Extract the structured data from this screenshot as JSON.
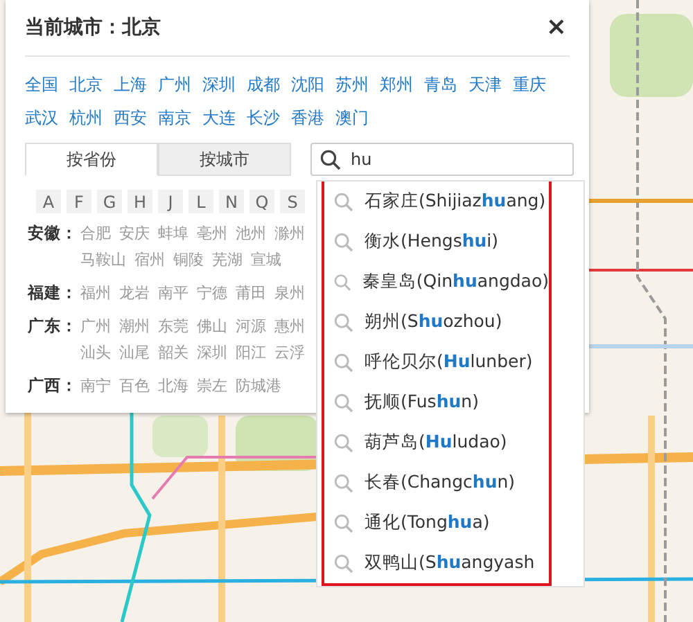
{
  "panel": {
    "title": "当前城市：北京",
    "close": "×",
    "hot_cities": [
      "全国",
      "北京",
      "上海",
      "广州",
      "深圳",
      "成都",
      "沈阳",
      "苏州",
      "郑州",
      "青岛",
      "天津",
      "重庆",
      "武汉",
      "杭州",
      "西安",
      "南京",
      "大连",
      "长沙",
      "香港",
      "澳门"
    ],
    "tabs": [
      {
        "label": "按省份",
        "selected": true
      },
      {
        "label": "按城市",
        "selected": false
      }
    ],
    "search": {
      "value": "hu"
    },
    "letters": [
      "A",
      "F",
      "G",
      "H",
      "J",
      "L",
      "N",
      "Q",
      "S"
    ],
    "provinces": [
      {
        "name": "安徽：",
        "cities": [
          "合肥",
          "安庆",
          "蚌埠",
          "亳州",
          "池州",
          "滁州",
          "马鞍山",
          "宿州",
          "铜陵",
          "芜湖",
          "宣城"
        ]
      },
      {
        "name": "福建：",
        "cities": [
          "福州",
          "龙岩",
          "南平",
          "宁德",
          "莆田",
          "泉州"
        ]
      },
      {
        "name": "广东：",
        "cities": [
          "广州",
          "潮州",
          "东莞",
          "佛山",
          "河源",
          "惠州",
          "汕头",
          "汕尾",
          "韶关",
          "深圳",
          "阳江",
          "云浮"
        ]
      },
      {
        "name": "广西：",
        "cities": [
          "南宁",
          "百色",
          "北海",
          "崇左",
          "防城港"
        ]
      }
    ]
  },
  "suggestions": [
    {
      "label": "石家庄(Shijiaz**hu**ang)"
    },
    {
      "label": "衡水(Hengs**hu**i)"
    },
    {
      "label": "秦皇岛(Qin**hu**angdao)"
    },
    {
      "label": "朔州(S**hu**ozhou)"
    },
    {
      "label": "呼伦贝尔(**Hu**lunber)"
    },
    {
      "label": "抚顺(Fus**hu**n)"
    },
    {
      "label": "葫芦岛(**Hu**ludao)"
    },
    {
      "label": "长春(Changc**hu**n)"
    },
    {
      "label": "通化(Tong**hu**a)"
    },
    {
      "label": "双鸭山(S**hu**angyash"
    }
  ]
}
